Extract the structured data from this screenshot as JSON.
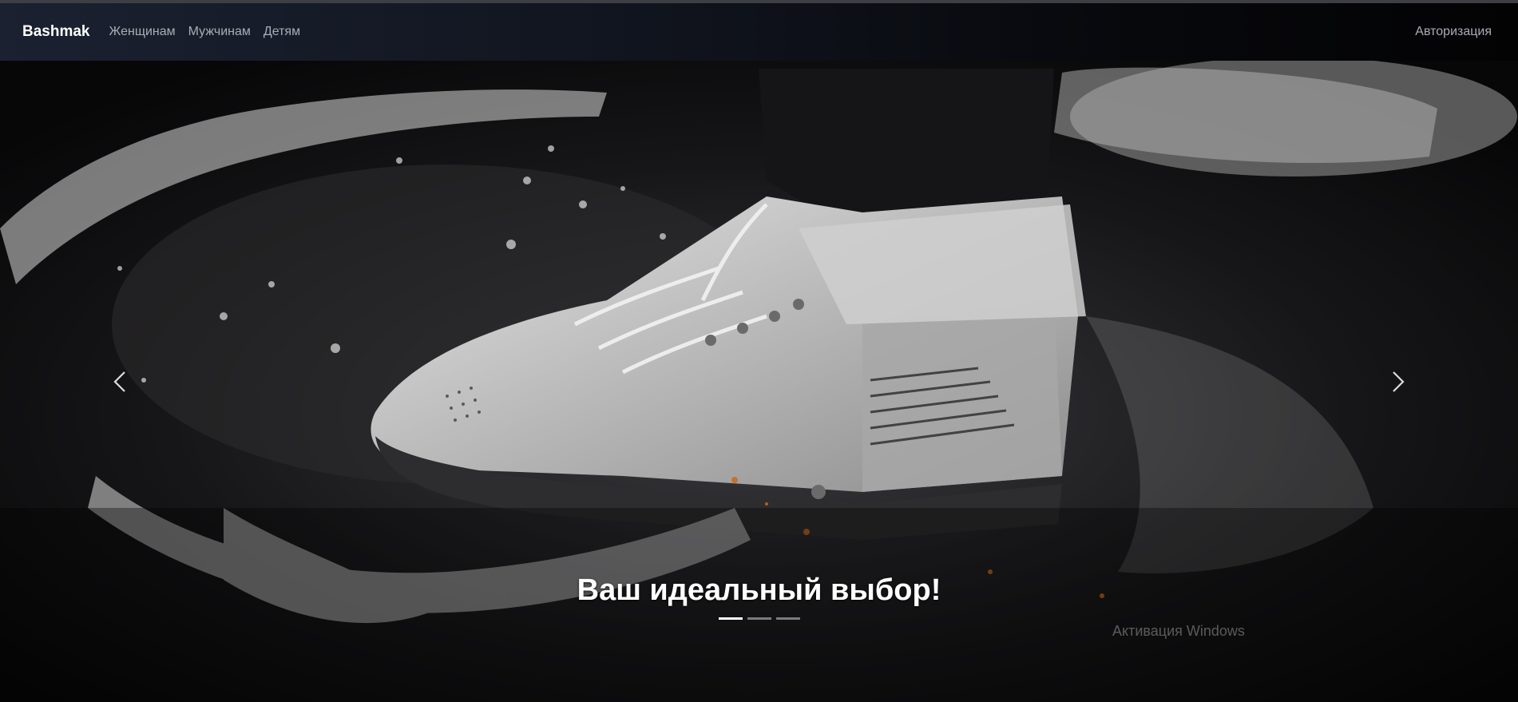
{
  "navbar": {
    "brand": "Bashmak",
    "links": [
      "Женщинам",
      "Мужчинам",
      "Детям"
    ],
    "auth_label": "Авторизация"
  },
  "carousel": {
    "caption": "Ваш идеальный выбор!",
    "slide_count": 3,
    "active_slide": 1,
    "prev_icon": "chevron-left-icon",
    "next_icon": "chevron-right-icon"
  },
  "system": {
    "watermark": "Активация Windows"
  },
  "colors": {
    "navbar_start": "#1b2131",
    "navbar_end": "#030304",
    "link_text": "#a9adb4",
    "brand_text": "#ffffff"
  }
}
